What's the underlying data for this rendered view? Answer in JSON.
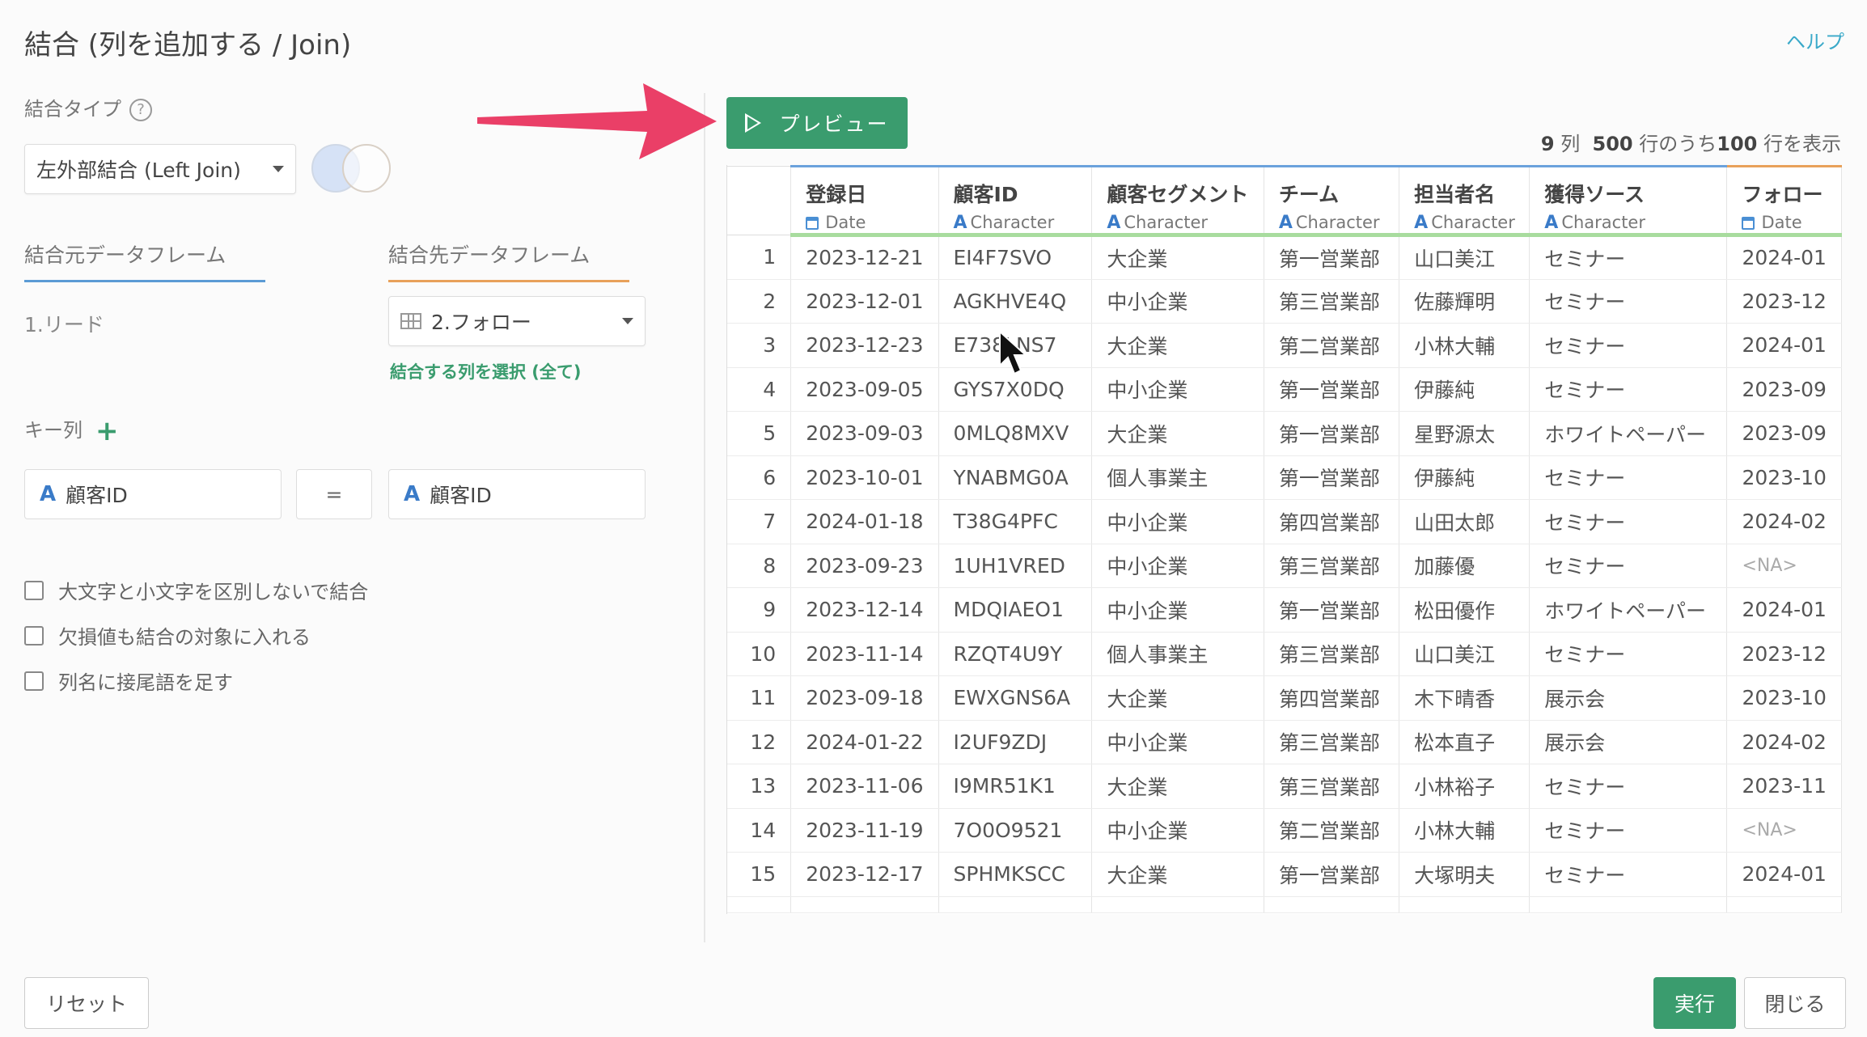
{
  "header": {
    "title": "結合 (列を追加する / Join)",
    "help": "ヘルプ"
  },
  "left": {
    "join_type_label": "結合タイプ",
    "join_type_value": "左外部結合 (Left Join)",
    "source_tab": "結合元データフレーム",
    "target_tab": "結合先データフレーム",
    "source_value": "1.リード",
    "target_value": "2.フォロー",
    "select_columns_link": "結合する列を選択 (全て)",
    "key_label": "キー列",
    "key_left": "顧客ID",
    "key_eq": "=",
    "key_right": "顧客ID",
    "checkbox1": "大文字と小文字を区別しないで結合",
    "checkbox2": "欠損値も結合の対象に入れる",
    "checkbox3": "列名に接尾語を足す"
  },
  "buttons": {
    "preview": "プレビュー",
    "reset": "リセット",
    "run": "実行",
    "close": "閉じる"
  },
  "rowinfo": {
    "cols": "9",
    "cols_unit": "列",
    "total": "500",
    "mid": "行のうち",
    "shown": "100",
    "tail": "行を表示"
  },
  "table": {
    "columns": [
      {
        "name": "登録日",
        "type": "Date"
      },
      {
        "name": "顧客ID",
        "type": "Character"
      },
      {
        "name": "顧客セグメント",
        "type": "Character"
      },
      {
        "name": "チーム",
        "type": "Character"
      },
      {
        "name": "担当者名",
        "type": "Character"
      },
      {
        "name": "獲得ソース",
        "type": "Character"
      },
      {
        "name": "フォロー",
        "type": "Date"
      }
    ],
    "rows": [
      [
        "1",
        "2023-12-21",
        "EI4F7SVO",
        "大企業",
        "第一営業部",
        "山口美江",
        "セミナー",
        "2024-01"
      ],
      [
        "2",
        "2023-12-01",
        "AGKHVE4Q",
        "中小企業",
        "第三営業部",
        "佐藤輝明",
        "セミナー",
        "2023-12"
      ],
      [
        "3",
        "2023-12-23",
        "E738LNS7",
        "大企業",
        "第二営業部",
        "小林大輔",
        "セミナー",
        "2024-01"
      ],
      [
        "4",
        "2023-09-05",
        "GYS7X0DQ",
        "中小企業",
        "第一営業部",
        "伊藤純",
        "セミナー",
        "2023-09"
      ],
      [
        "5",
        "2023-09-03",
        "0MLQ8MXV",
        "大企業",
        "第一営業部",
        "星野源太",
        "ホワイトペーパー",
        "2023-09"
      ],
      [
        "6",
        "2023-10-01",
        "YNABMG0A",
        "個人事業主",
        "第一営業部",
        "伊藤純",
        "セミナー",
        "2023-10"
      ],
      [
        "7",
        "2024-01-18",
        "T38G4PFC",
        "中小企業",
        "第四営業部",
        "山田太郎",
        "セミナー",
        "2024-02"
      ],
      [
        "8",
        "2023-09-23",
        "1UH1VRED",
        "中小企業",
        "第三営業部",
        "加藤優",
        "セミナー",
        "<NA>"
      ],
      [
        "9",
        "2023-12-14",
        "MDQIAEO1",
        "中小企業",
        "第一営業部",
        "松田優作",
        "ホワイトペーパー",
        "2024-01"
      ],
      [
        "10",
        "2023-11-14",
        "RZQT4U9Y",
        "個人事業主",
        "第三営業部",
        "山口美江",
        "セミナー",
        "2023-12"
      ],
      [
        "11",
        "2023-09-18",
        "EWXGNS6A",
        "大企業",
        "第四営業部",
        "木下晴香",
        "展示会",
        "2023-10"
      ],
      [
        "12",
        "2024-01-22",
        "I2UF9ZDJ",
        "中小企業",
        "第三営業部",
        "松本直子",
        "展示会",
        "2024-02"
      ],
      [
        "13",
        "2023-11-06",
        "I9MR51K1",
        "大企業",
        "第三営業部",
        "小林裕子",
        "セミナー",
        "2023-11"
      ],
      [
        "14",
        "2023-11-19",
        "7O0O9521",
        "中小企業",
        "第二営業部",
        "小林大輔",
        "セミナー",
        "<NA>"
      ],
      [
        "15",
        "2023-12-17",
        "SPHMKSCC",
        "大企業",
        "第一営業部",
        "大塚明夫",
        "セミナー",
        "2024-01"
      ]
    ]
  },
  "colors": {
    "accent_green": "#3a9c6e",
    "source_tab": "#5b9bd5",
    "target_tab": "#e8a15a",
    "arrow": "#ea3f67"
  }
}
